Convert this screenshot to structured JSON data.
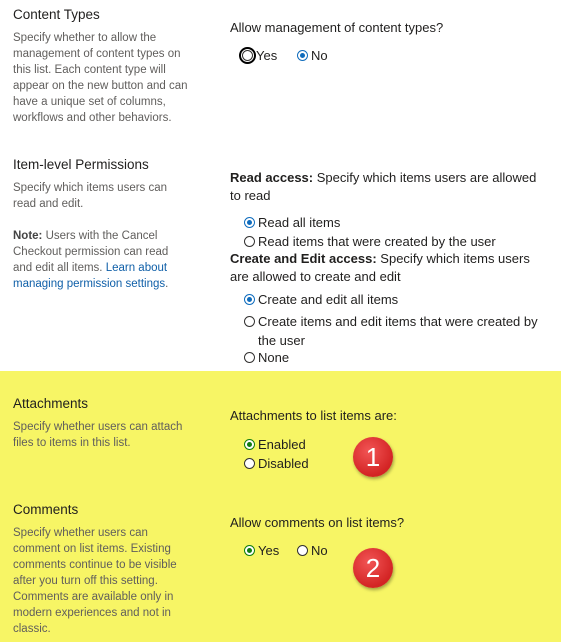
{
  "content_types": {
    "title": "Content Types",
    "description": "Specify whether to allow the management of content types on this list. Each content type will appear on the new button and can have a unique set of columns, workflows and other behaviors.",
    "question": "Allow management of content types?",
    "options": [
      "Yes",
      "No"
    ],
    "selected": "No"
  },
  "item_permissions": {
    "title": "Item-level Permissions",
    "description": "Specify which items users can read and edit.",
    "note_label": "Note:",
    "note_text": " Users with the Cancel Checkout permission can read and edit all items. ",
    "note_link": "Learn about managing permission settings",
    "note_end": ".",
    "read_label": "Read access:",
    "read_text": "  Specify which items users are allowed to read",
    "read_options": [
      "Read all items",
      "Read items that were created by the user"
    ],
    "read_selected": "Read all items",
    "edit_label": "Create and Edit access:",
    "edit_text": "  Specify which items users are allowed to create and edit",
    "edit_options": [
      "Create and edit all items",
      "Create items and edit items that were created by the user",
      "None"
    ],
    "edit_selected": "Create and edit all items"
  },
  "attachments": {
    "title": "Attachments",
    "description": "Specify whether users can attach files to items in this list.",
    "question": "Attachments to list items are:",
    "options": [
      "Enabled",
      "Disabled"
    ],
    "selected": "Enabled",
    "badge": "1"
  },
  "comments": {
    "title": "Comments",
    "description": "Specify whether users can comment on list items. Existing comments continue to be visible after you turn off this setting. Comments are available only in modern experiences and not in classic.",
    "question": "Allow comments on list items?",
    "options": [
      "Yes",
      "No"
    ],
    "selected": "Yes",
    "badge": "2"
  },
  "colors": {
    "highlight": "#f7f565",
    "badge": "#d32424",
    "radio_blue": "#0f6cbd",
    "radio_green": "#107c10",
    "link": "#0f5fa8"
  }
}
